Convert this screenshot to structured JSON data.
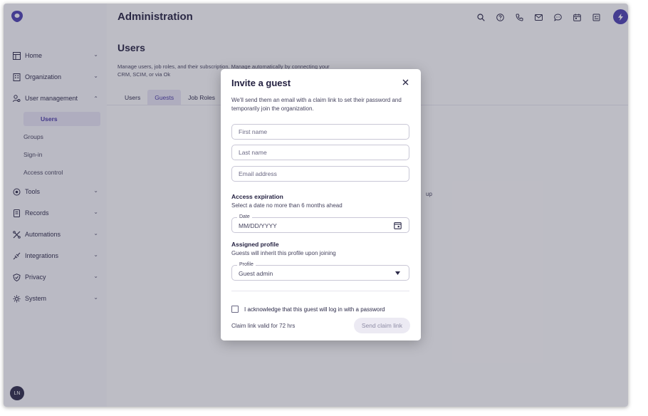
{
  "header": {
    "title": "Administration"
  },
  "sidebar": {
    "items": [
      {
        "label": "Home",
        "icon": "layout-icon"
      },
      {
        "label": "Organization",
        "icon": "building-icon"
      },
      {
        "label": "User management",
        "icon": "users-icon"
      },
      {
        "label": "Tools",
        "icon": "tools-icon"
      },
      {
        "label": "Records",
        "icon": "records-icon"
      },
      {
        "label": "Automations",
        "icon": "automations-icon"
      },
      {
        "label": "Integrations",
        "icon": "integrations-icon"
      },
      {
        "label": "Privacy",
        "icon": "shield-icon"
      },
      {
        "label": "System",
        "icon": "system-icon"
      }
    ],
    "subitems": [
      "Users",
      "Groups",
      "Sign-in",
      "Access control"
    ],
    "avatar": "LN"
  },
  "main": {
    "title": "Users",
    "description": "Manage users, job roles, and their subscription. Manage automatically by connecting your CRM, SCIM, or via Ok",
    "tabs": [
      "Users",
      "Guests",
      "Job Roles"
    ],
    "background_fragment": "up"
  },
  "modal": {
    "title": "Invite a guest",
    "description": "We'll send them an email with a claim link to set their password and temporarily join the organization.",
    "first_name_placeholder": "First name",
    "last_name_placeholder": "Last name",
    "email_placeholder": "Email address",
    "access_title": "Access expiration",
    "access_subtitle": "Select a date no more than 6 months ahead",
    "date_label": "Date",
    "date_placeholder": "MM/DD/YYYY",
    "profile_title": "Assigned profile",
    "profile_subtitle": "Guests will inherit this profile upon joining",
    "profile_label": "Profile",
    "profile_value": "Guest admin",
    "acknowledge": "I acknowledge that this guest will log in with a password",
    "footer_text": "Claim link valid for 72 hrs",
    "send_label": "Send claim link"
  },
  "colors": {
    "accent": "#4b3fb0",
    "active_bg": "#e6e3f4"
  }
}
